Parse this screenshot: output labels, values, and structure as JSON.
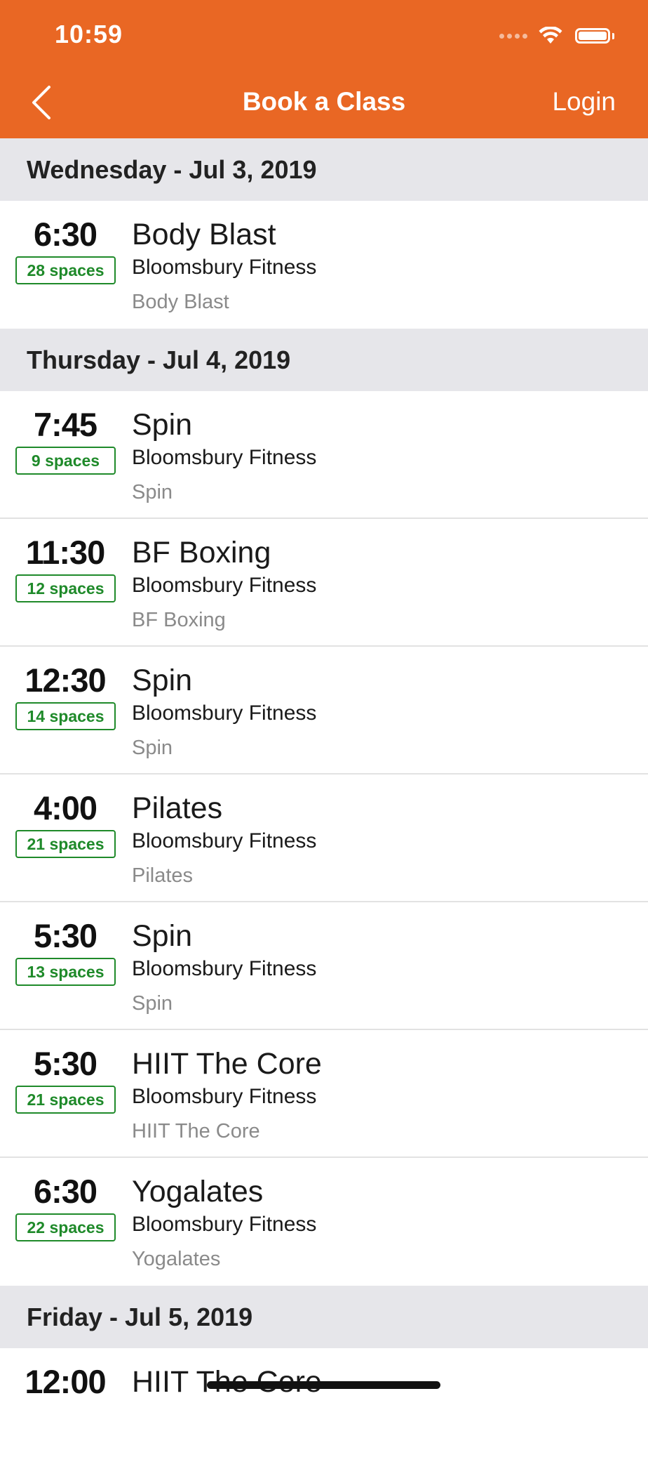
{
  "status_bar": {
    "time": "10:59"
  },
  "nav": {
    "title": "Book a Class",
    "login_label": "Login"
  },
  "days": [
    {
      "header": "Wednesday - Jul 3, 2019",
      "classes": [
        {
          "time": "6:30",
          "spaces": "28 spaces",
          "title": "Body Blast",
          "studio": "Bloomsbury Fitness",
          "sub": "Body Blast"
        }
      ]
    },
    {
      "header": "Thursday - Jul 4, 2019",
      "classes": [
        {
          "time": "7:45",
          "spaces": "9 spaces",
          "title": "Spin",
          "studio": "Bloomsbury Fitness",
          "sub": "Spin"
        },
        {
          "time": "11:30",
          "spaces": "12 spaces",
          "title": "BF Boxing",
          "studio": "Bloomsbury Fitness",
          "sub": "BF Boxing"
        },
        {
          "time": "12:30",
          "spaces": "14 spaces",
          "title": "Spin",
          "studio": "Bloomsbury Fitness",
          "sub": "Spin"
        },
        {
          "time": "4:00",
          "spaces": "21 spaces",
          "title": "Pilates",
          "studio": "Bloomsbury Fitness",
          "sub": "Pilates"
        },
        {
          "time": "5:30",
          "spaces": "13 spaces",
          "title": "Spin",
          "studio": "Bloomsbury Fitness",
          "sub": "Spin"
        },
        {
          "time": "5:30",
          "spaces": "21 spaces",
          "title": "HIIT The Core",
          "studio": "Bloomsbury Fitness",
          "sub": "HIIT The Core"
        },
        {
          "time": "6:30",
          "spaces": "22 spaces",
          "title": "Yogalates",
          "studio": "Bloomsbury Fitness",
          "sub": "Yogalates"
        }
      ]
    },
    {
      "header": "Friday - Jul 5, 2019",
      "classes": [
        {
          "time": "12:00",
          "title": "HIIT The Core"
        }
      ]
    }
  ],
  "colors": {
    "accent": "#E96724",
    "spaces_green": "#1F8A2A",
    "section_bg": "#E6E6EA"
  }
}
